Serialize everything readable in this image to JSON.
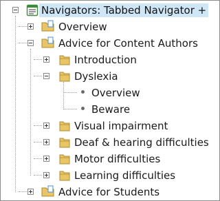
{
  "tree": {
    "root": {
      "label": "Navigators: Tabbed Navigator +",
      "icon": "list-document-icon",
      "selected": true,
      "expanded": true
    },
    "nodes": [
      {
        "label": "Overview",
        "icon": "page-folder-icon",
        "expanded": false
      },
      {
        "label": "Advice for Content Authors",
        "icon": "page-folder-icon",
        "expanded": true,
        "children": [
          {
            "label": "Introduction",
            "icon": "folder-icon",
            "expanded": false
          },
          {
            "label": "Dyslexia",
            "icon": "folder-icon",
            "expanded": true,
            "children": [
              {
                "label": "Overview",
                "icon": "bullet-icon"
              },
              {
                "label": "Beware",
                "icon": "bullet-icon"
              }
            ]
          },
          {
            "label": "Visual impairment",
            "icon": "folder-icon",
            "expanded": false
          },
          {
            "label": "Deaf & hearing difficulties",
            "icon": "folder-icon",
            "expanded": false
          },
          {
            "label": "Motor difficulties",
            "icon": "folder-icon",
            "expanded": false
          },
          {
            "label": "Learning difficulties",
            "icon": "folder-icon",
            "expanded": false
          }
        ]
      },
      {
        "label": "Advice for Students",
        "icon": "page-folder-icon",
        "expanded": false
      }
    ]
  },
  "colors": {
    "selection": "#cfe6f6",
    "folder": "#e8c667",
    "page": "#4f8fd6",
    "doc_icon": "#3a8a3a"
  }
}
